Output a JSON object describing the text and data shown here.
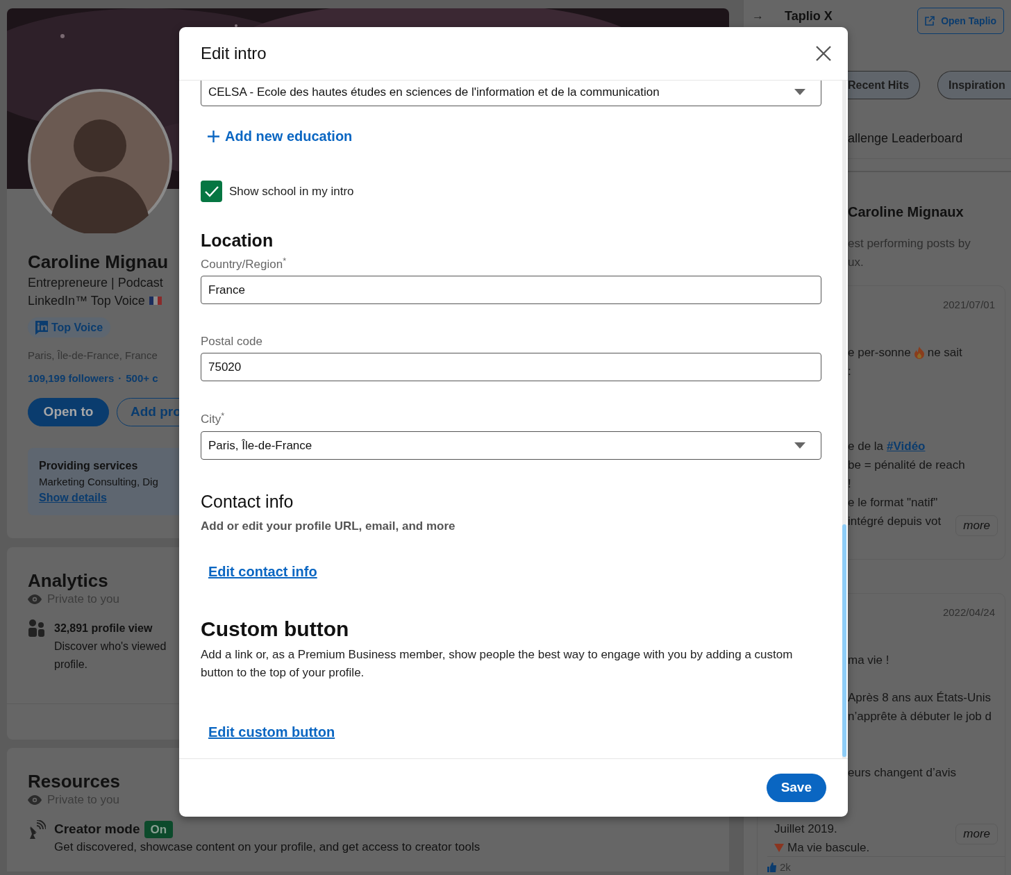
{
  "profile": {
    "name": "Caroline Mignau",
    "headline": [
      "Entrepreneure | Podcast",
      "LinkedIn™ Top Voice"
    ],
    "badge": "Top Voice",
    "location": "Paris, Île-de-France, France",
    "followers": "109,199 followers",
    "separator": "·",
    "connections": "500+ c",
    "buttons": [
      {
        "label": "Open to",
        "kind": "primary"
      },
      {
        "label": "Add pro",
        "kind": "outline"
      }
    ],
    "services": {
      "title": "Providing services",
      "text": "Marketing Consulting, Dig",
      "link": "Show details"
    }
  },
  "analytics": {
    "title": "Analytics",
    "privacy": "Private to you",
    "stat": "32,891 profile view",
    "text": [
      "Discover who's viewed",
      "profile."
    ]
  },
  "resources": {
    "title": "Resources",
    "privacy": "Private to you",
    "item": {
      "title": "Creator mode",
      "status": "On",
      "on": true,
      "text": "Get discovered, showcase content on your profile, and get access to creator tools"
    }
  },
  "sidebar": {
    "arrow": "→",
    "title": "Taplio X",
    "open_button": "Open Taplio",
    "pills": [
      "Recent Hits",
      "Inspiration"
    ],
    "menu_item": "allenge Leaderboard",
    "section_title": "Caroline Mignaux",
    "section_text": [
      "est performing posts by",
      "ux."
    ],
    "posts": [
      {
        "date": "2021/07/01",
        "more": "more",
        "lines": [
          {
            "parts": [
              {
                "kind": "text",
                "text": "e per-sonne"
              },
              {
                "kind": "flame"
              },
              {
                "kind": "text",
                "text": "ne sait"
              }
            ]
          },
          {
            "parts": [
              {
                "kind": "text",
                "text": ":"
              }
            ]
          },
          {
            "kind": "blank"
          },
          {
            "kind": "blank"
          },
          {
            "kind": "blank"
          },
          {
            "parts": [
              {
                "kind": "text",
                "text": "e de la"
              },
              {
                "kind": "hashtag",
                "text": "#Vidéo"
              }
            ]
          },
          {
            "parts": [
              {
                "kind": "text",
                "text": "be = pénalité de reach"
              }
            ]
          },
          {
            "parts": [
              {
                "kind": "text",
                "text": "!"
              }
            ]
          },
          {
            "parts": [
              {
                "kind": "text",
                "text": "e le format \"natif\""
              }
            ]
          },
          {
            "parts": [
              {
                "kind": "text",
                "text": "intégré depuis vot"
              }
            ]
          }
        ]
      },
      {
        "date": "2022/04/24",
        "more": "more",
        "likes": "2k",
        "lines": [
          {
            "parts": [
              {
                "kind": "text",
                "text": "ma vie !"
              }
            ]
          },
          {
            "kind": "blank"
          },
          {
            "parts": [
              {
                "kind": "text",
                "text": "Après 8 ans aux États-Unis"
              }
            ]
          },
          {
            "parts": [
              {
                "kind": "text",
                "text": "n’apprête à débuter le job d"
              }
            ]
          },
          {
            "kind": "blank"
          },
          {
            "kind": "blank"
          },
          {
            "parts": [
              {
                "kind": "text",
                "text": "eurs changent d’avis"
              }
            ]
          }
        ],
        "lines_below": [
          {
            "kind": "blank"
          },
          {
            "kind": "blank"
          },
          {
            "parts": [
              {
                "kind": "text",
                "text": "Juillet 2019."
              }
            ]
          },
          {
            "parts": [
              {
                "kind": "triangle"
              },
              {
                "kind": "text",
                "text": "Ma vie bascule."
              }
            ]
          }
        ]
      }
    ]
  },
  "dialog": {
    "title": "Edit intro",
    "school": "CELSA - Ecole des hautes études en sciences de l'information et de la communication",
    "add_education": "Add new education",
    "show_school": {
      "label": "Show school in my intro",
      "checked": true
    },
    "location": {
      "title": "Location",
      "country": {
        "label": "Country/Region$^{*}$",
        "value": "France"
      },
      "postal": {
        "label": "Postal code",
        "value": "75020"
      },
      "city": {
        "label": "City$^{*}$",
        "value": "Paris, Île-de-France"
      }
    },
    "contact": {
      "title": "Contact info",
      "text": "Add or edit your profile URL, email, and more",
      "link": "Edit contact info"
    },
    "custom_button": {
      "title": "Custom button",
      "text": "Add a link or, as a Premium Business member, show people the best way to engage with you by adding a custom button to the top of your profile.",
      "link": "Edit custom button"
    },
    "save": "Save"
  }
}
